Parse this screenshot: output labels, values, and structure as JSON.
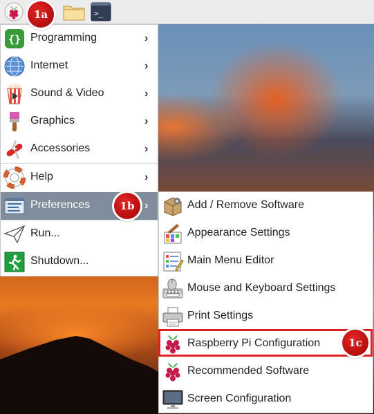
{
  "taskbar": {
    "icons": [
      "raspberry-pi-menu-icon",
      "browser-globe-icon",
      "file-manager-folder-icon",
      "terminal-icon"
    ],
    "terminal_prompt": ">_"
  },
  "main_menu": {
    "items": [
      {
        "label": "Programming",
        "icon": "programming-icon",
        "submenu": true
      },
      {
        "label": "Internet",
        "icon": "internet-globe-icon",
        "submenu": true
      },
      {
        "label": "Sound & Video",
        "icon": "sound-video-icon",
        "submenu": true
      },
      {
        "label": "Graphics",
        "icon": "graphics-brush-icon",
        "submenu": true
      },
      {
        "label": "Accessories",
        "icon": "accessories-knife-icon",
        "submenu": true
      },
      {
        "label": "Help",
        "icon": "help-lifebuoy-icon",
        "submenu": true
      },
      {
        "label": "Preferences",
        "icon": "preferences-icon",
        "submenu": true,
        "active": true
      },
      {
        "label": "Run...",
        "icon": "run-paper-plane-icon",
        "submenu": false
      },
      {
        "label": "Shutdown...",
        "icon": "shutdown-exit-icon",
        "submenu": false
      }
    ],
    "chevron": "›"
  },
  "preferences_submenu": {
    "items": [
      {
        "label": "Add / Remove Software",
        "icon": "package-box-icon"
      },
      {
        "label": "Appearance Settings",
        "icon": "appearance-palette-icon"
      },
      {
        "label": "Main Menu Editor",
        "icon": "menu-editor-icon"
      },
      {
        "label": "Mouse and Keyboard Settings",
        "icon": "mouse-keyboard-icon"
      },
      {
        "label": "Print Settings",
        "icon": "printer-icon"
      },
      {
        "label": "Raspberry Pi Configuration",
        "icon": "raspberry-pi-icon",
        "highlighted": true
      },
      {
        "label": "Recommended Software",
        "icon": "raspberry-pi-icon"
      },
      {
        "label": "Screen Configuration",
        "icon": "monitor-icon"
      }
    ]
  },
  "annotations": {
    "badge_1a": "1a",
    "badge_1b": "1b",
    "badge_1c": "1c"
  },
  "colors": {
    "active_item_bg": "#7f8d9c",
    "highlight_border": "#e02020",
    "badge_red": "#c41414"
  }
}
